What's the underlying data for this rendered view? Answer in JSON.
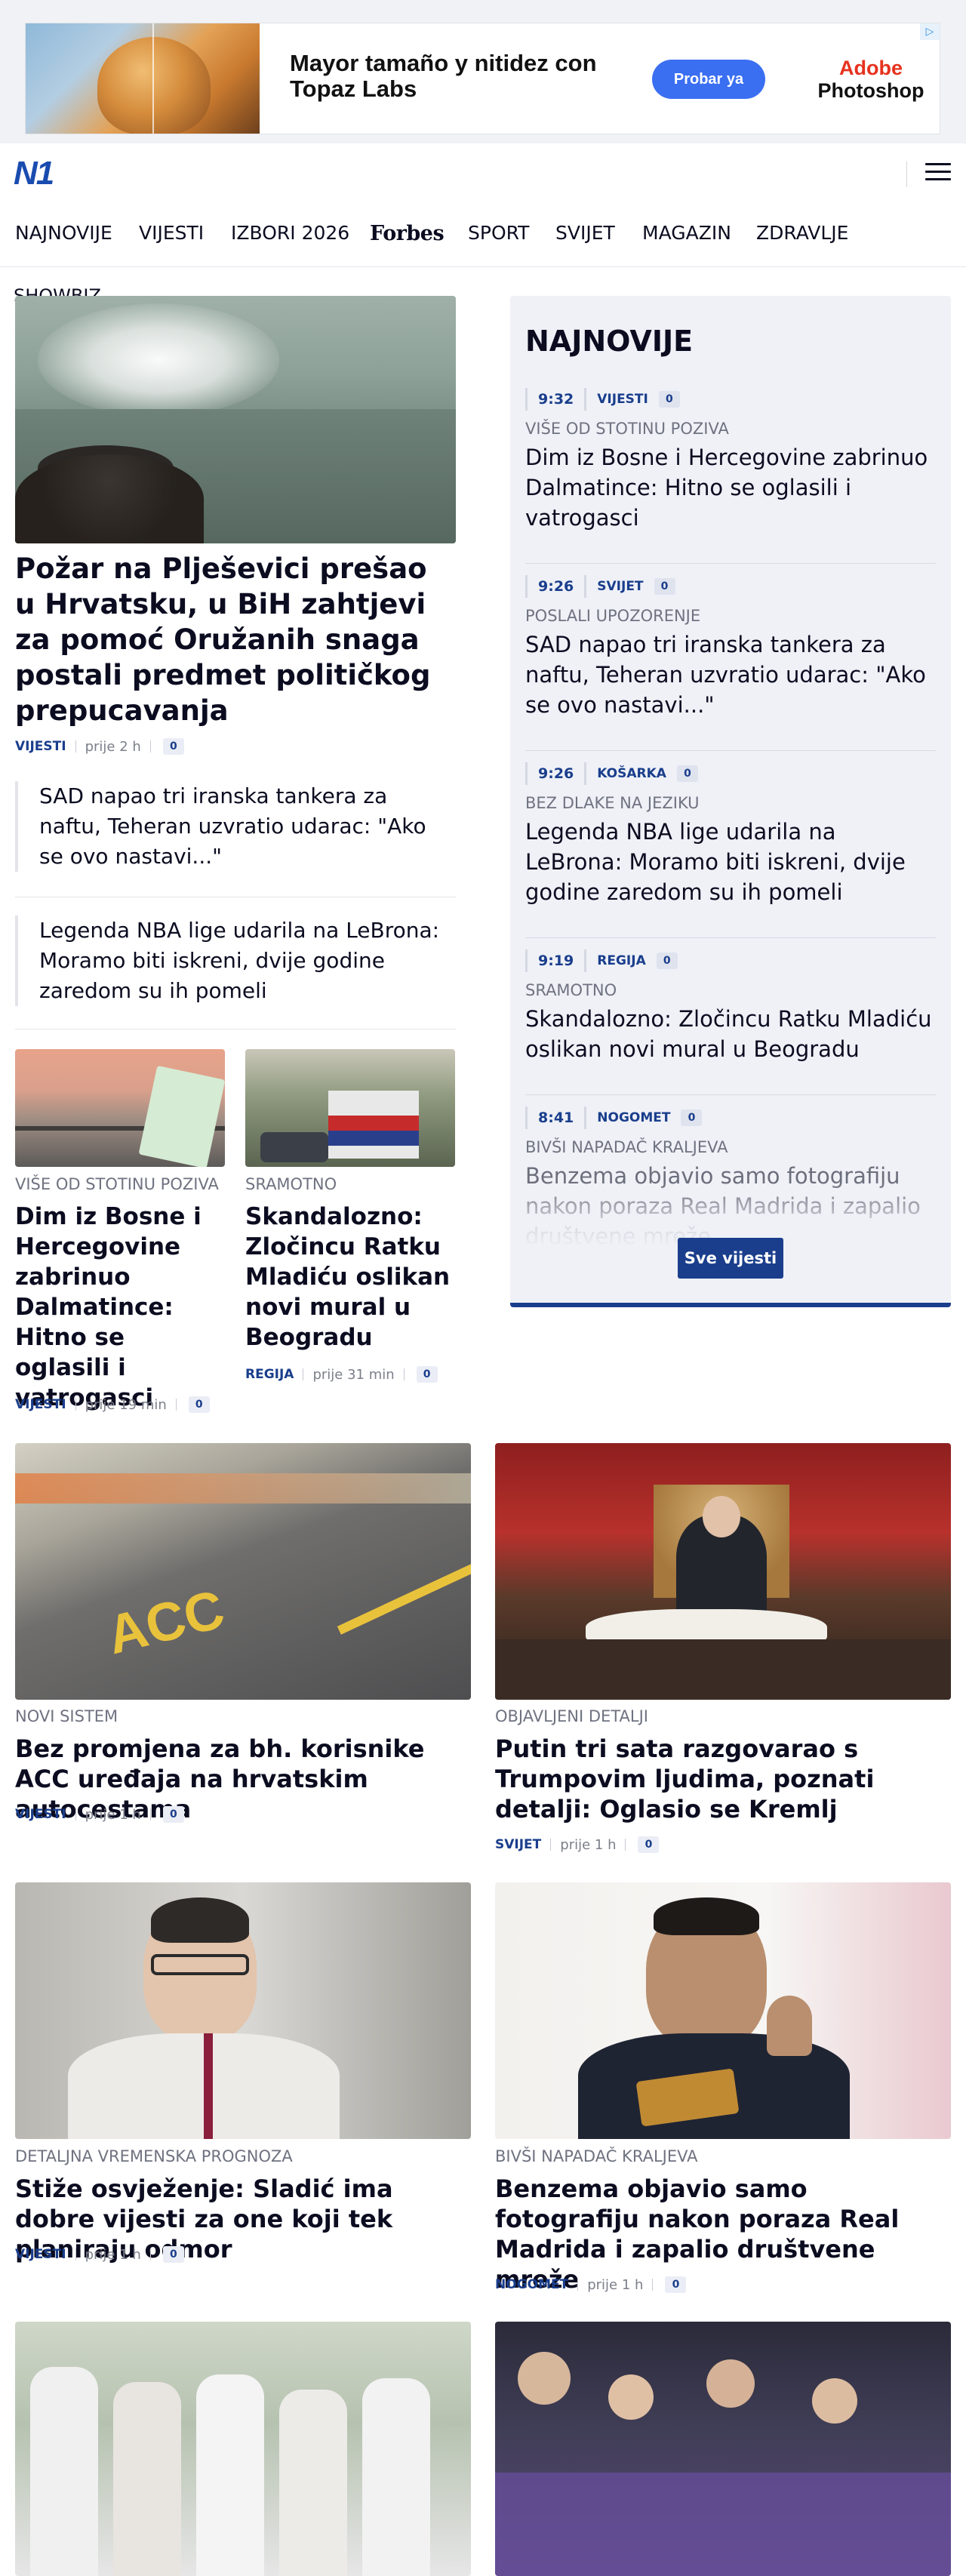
{
  "ad": {
    "headline": "Mayor tamaño y nitidez con Topaz Labs",
    "cta": "Probar ya",
    "brand_line1": "Adobe",
    "brand_line2": "Photoshop"
  },
  "header": {
    "logo": "N1"
  },
  "nav": {
    "items": [
      "NAJNOVIJE",
      "VIJESTI",
      "IZBORI 2026",
      "Forbes",
      "SPORT",
      "SVIJET",
      "MAGAZIN",
      "ZDRAVLJE",
      "SHOWBIZ"
    ]
  },
  "lead": {
    "title": "Požar na Plješevici prešao u Hrvatsku, u BiH zahtjevi za pomoć Oružanih snaga postali predmet političkog prepucavanja",
    "category": "VIJESTI",
    "time": "prije 2 h",
    "comments": "0"
  },
  "sub_stories": [
    "SAD napao tri iranska tankera za naftu, Teheran uzvratio udarac: \"Ako se ovo nastavi...\"",
    "Legenda NBA lige udarila na LeBrona: Moramo biti iskreni, dvije godine zaredom su ih pomeli"
  ],
  "mini_stories": [
    {
      "kicker": "VIŠE OD STOTINU POZIVA",
      "title": "Dim iz Bosne i Hercegovine zabrinuo Dalmatince: Hitno se oglasili i vatrogasci",
      "category": "VIJESTI",
      "time": "prije 19 min",
      "comments": "0"
    },
    {
      "kicker": "SRAMOTNO",
      "title": "Skandalozno: Zločincu Ratku Mladiću oslikan novi mural u Beogradu",
      "category": "REGIJA",
      "time": "prije 31 min",
      "comments": "0"
    }
  ],
  "sidebar": {
    "title": "NAJNOVIJE",
    "items": [
      {
        "time": "9:32",
        "category": "VIJESTI",
        "comments": "0",
        "kicker": "VIŠE OD STOTINU POZIVA",
        "headline": "Dim iz Bosne i Hercegovine zabrinuo Dalmatince: Hitno se oglasili i vatrogasci"
      },
      {
        "time": "9:26",
        "category": "SVIJET",
        "comments": "0",
        "kicker": "POSLALI UPOZORENJE",
        "headline": "SAD napao tri iranska tankera za naftu, Teheran uzvratio udarac: \"Ako se ovo nastavi...\""
      },
      {
        "time": "9:26",
        "category": "KOŠARKA",
        "comments": "0",
        "kicker": "BEZ DLAKE NA JEZIKU",
        "headline": "Legenda NBA lige udarila na LeBrona: Moramo biti iskreni, dvije godine zaredom su ih pomeli"
      },
      {
        "time": "9:19",
        "category": "REGIJA",
        "comments": "0",
        "kicker": "SRAMOTNO",
        "headline": "Skandalozno: Zločincu Ratku Mladiću oslikan novi mural u Beogradu"
      },
      {
        "time": "8:41",
        "category": "NOGOMET",
        "comments": "0",
        "kicker": "BIVŠI NAPADAČ KRALJEVA",
        "headline": "Benzema objavio samo fotografiju nakon poraza Real Madrida i zapalio društvene mreže"
      }
    ],
    "button": "Sve vijesti"
  },
  "grid": [
    {
      "kicker": "NOVI SISTEM",
      "title": "Bez promjena za bh. korisnike ACC uređaja na hrvatskim autocestama",
      "category": "VIJESTI",
      "time": "prije 1 h",
      "comments": "0"
    },
    {
      "kicker": "OBJAVLJENI DETALJI",
      "title": "Putin tri sata razgovarao s Trumpovim ljudima, poznati detalji: Oglasio se Kremlj",
      "category": "SVIJET",
      "time": "prije 1 h",
      "comments": "0"
    },
    {
      "kicker": "DETALJNA VREMENSKA PROGNOZA",
      "title": "Stiže osvježenje: Sladić ima dobre vijesti za one koji tek planiraju odmor",
      "category": "VIJESTI",
      "time": "prije 1 h",
      "comments": "0"
    },
    {
      "kicker": "BIVŠI NAPADAČ KRALJEVA",
      "title": "Benzema objavio samo fotografiju nakon poraza Real Madrida i zapalio društvene mreže",
      "category": "NOGOMET",
      "time": "prije 1 h",
      "comments": "0"
    }
  ]
}
